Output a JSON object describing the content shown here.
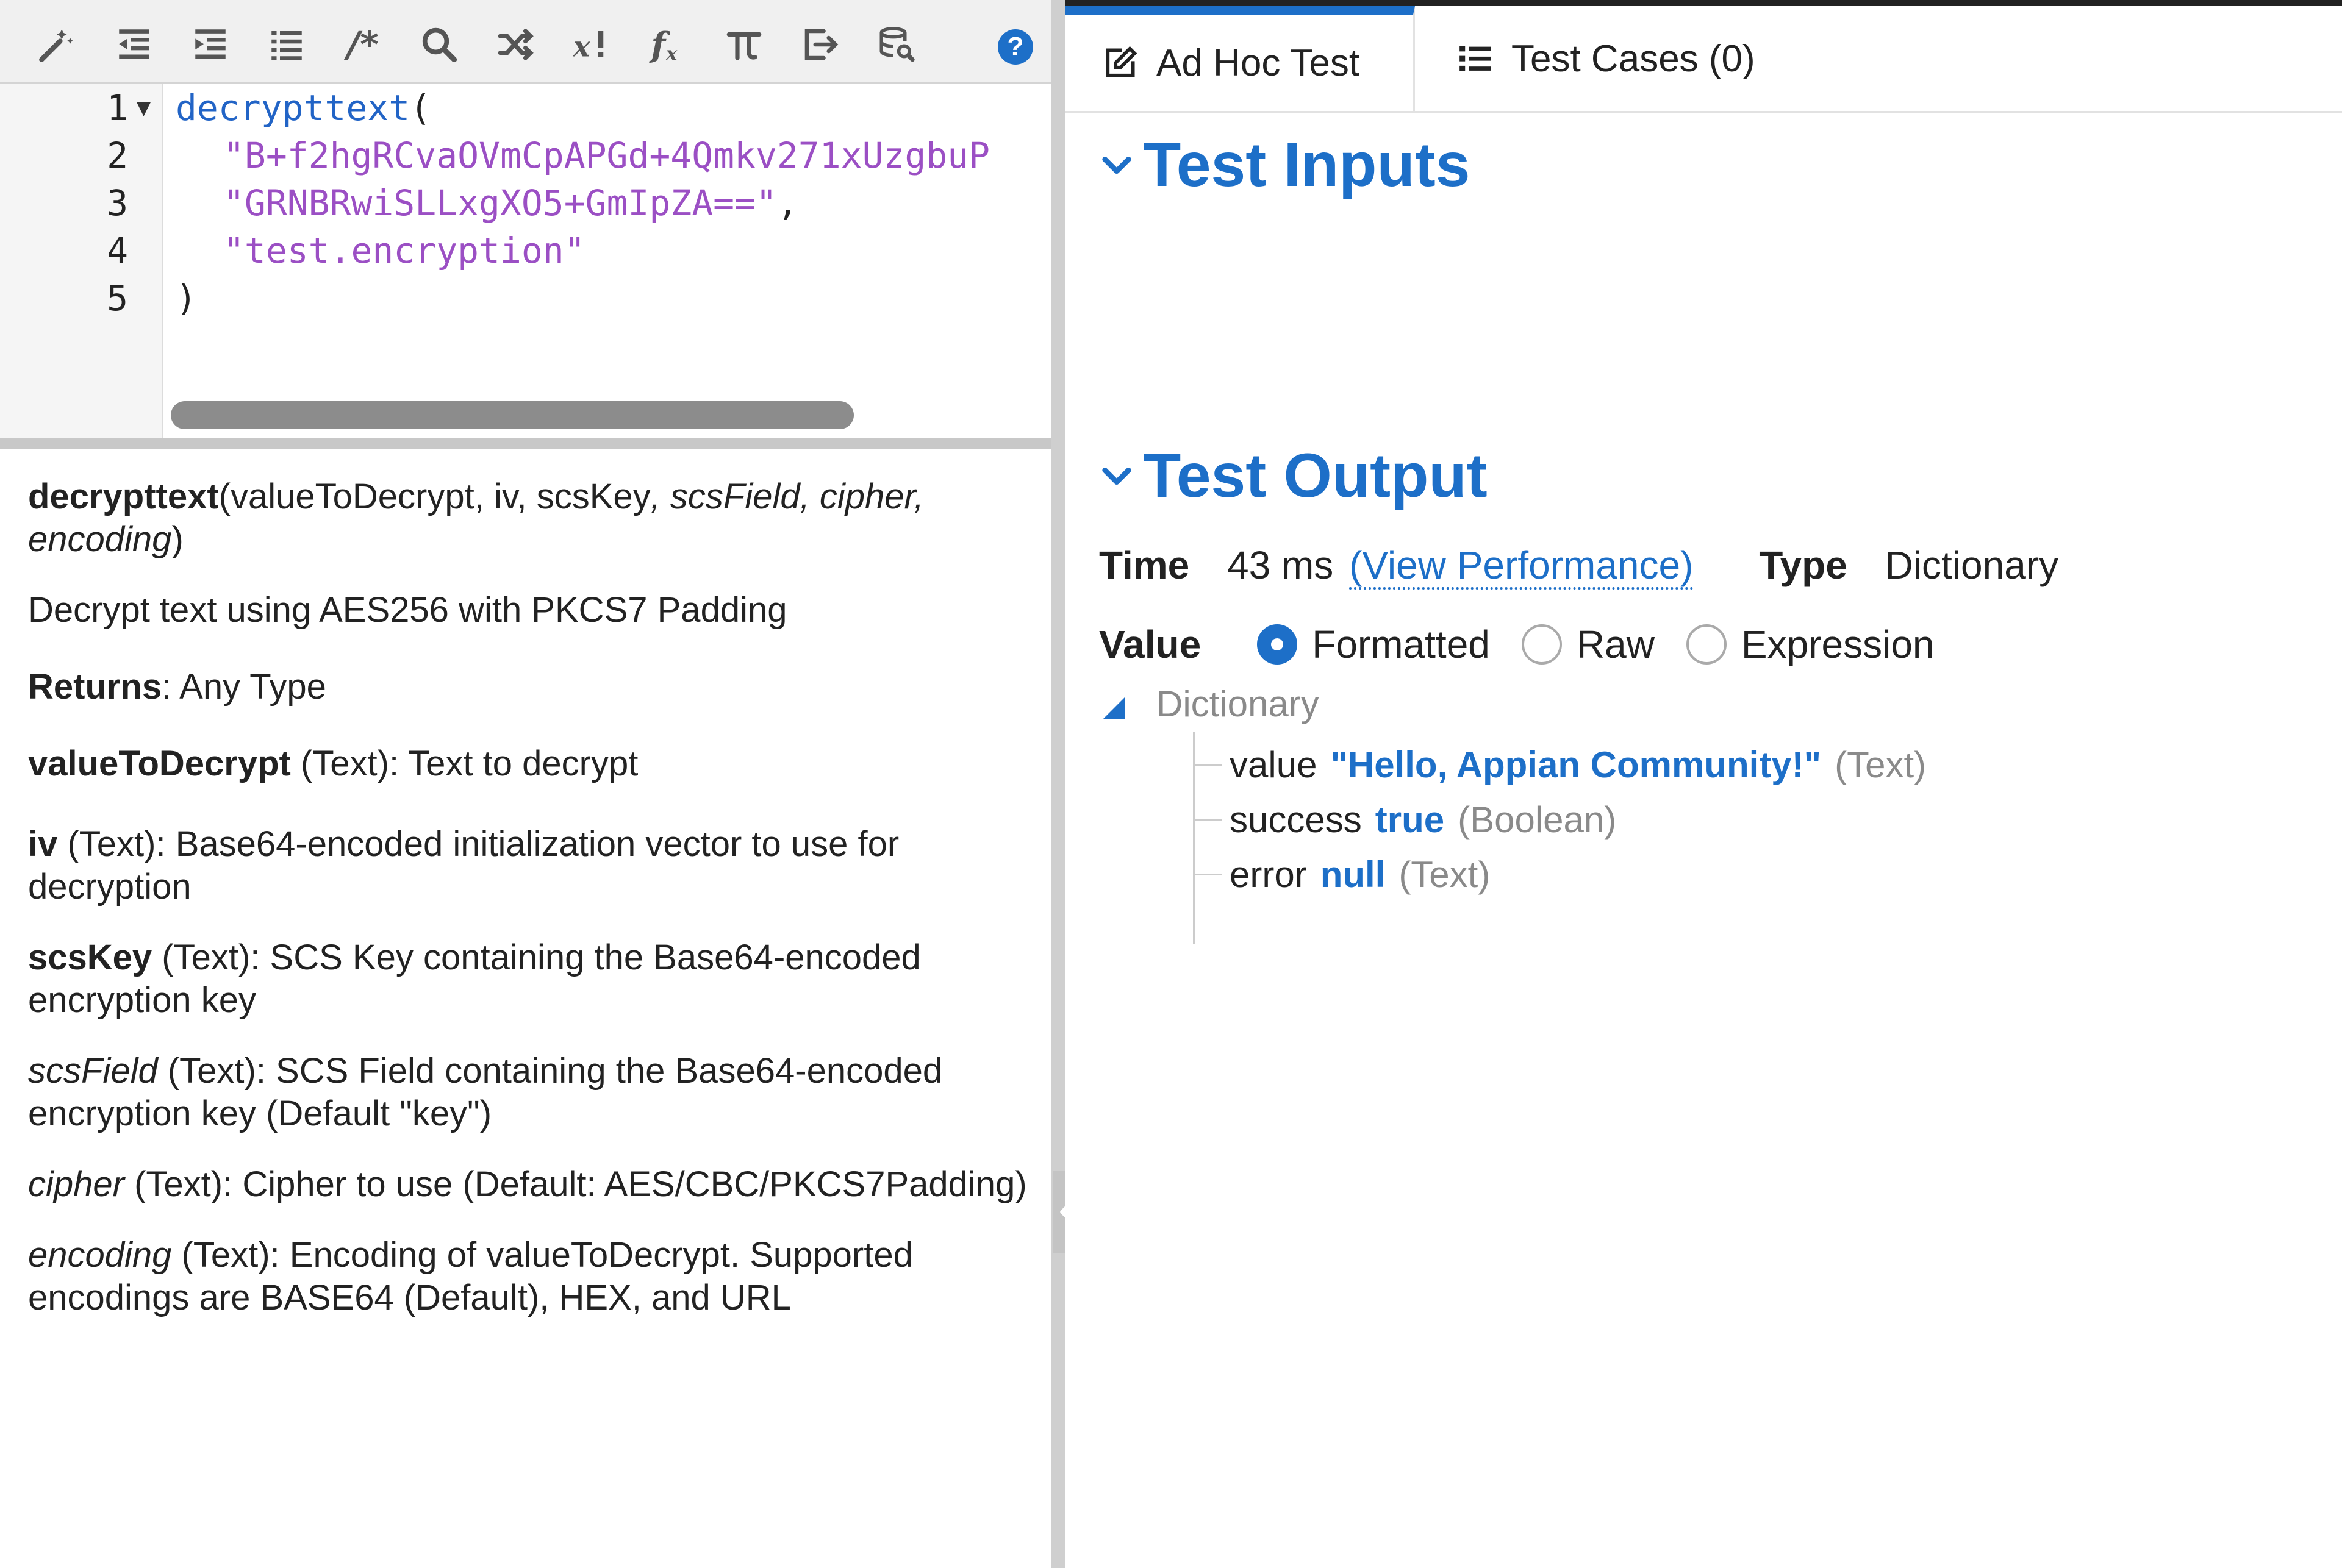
{
  "toolbar": {
    "icons": [
      "magic-wand-icon",
      "outdent-icon",
      "indent-icon",
      "list-icon",
      "comment-icon",
      "search-icon",
      "shuffle-icon",
      "variable-icon",
      "function-icon",
      "pi-icon",
      "export-icon",
      "database-search-icon",
      "help-icon"
    ],
    "comment_glyph": "/*",
    "help_glyph": "?"
  },
  "editor": {
    "line_numbers": [
      "1",
      "2",
      "3",
      "4",
      "5"
    ],
    "line1_fn": "decrypttext",
    "line1_paren": "(",
    "line2_str": "\"B+f2hgRCvaOVmCpAPGd+4Qmkv271xUzgbuP",
    "line3_str": "\"GRNBRwiSLLxgXO5+GmIpZA==\"",
    "line3_comma": ",",
    "line4_str": "\"test.encryption\"",
    "line5_paren": ")"
  },
  "docs": {
    "signature_name": "decrypttext",
    "signature_required": "(valueToDecrypt, iv, scsKey",
    "signature_optional": ", scsField, cipher, encoding",
    "signature_close": ")",
    "description": "Decrypt text using AES256 with PKCS7 Padding",
    "returns_label": "Returns",
    "returns_value": ": Any Type",
    "params": [
      {
        "name": "valueToDecrypt",
        "desc": " (Text): Text to decrypt",
        "optional": false
      },
      {
        "name": "iv",
        "desc": " (Text): Base64-encoded initialization vector to use for decryption",
        "optional": false
      },
      {
        "name": "scsKey",
        "desc": " (Text): SCS Key containing the Base64-encoded encryption key",
        "optional": false
      },
      {
        "name": "scsField",
        "desc": " (Text): SCS Field containing the Base64-encoded encryption key (Default \"key\")",
        "optional": true
      },
      {
        "name": "cipher",
        "desc": " (Text): Cipher to use (Default: AES/CBC/PKCS7Padding)",
        "optional": true
      },
      {
        "name": "encoding",
        "desc": " (Text): Encoding of valueToDecrypt. Supported encodings are BASE64 (Default), HEX, and URL",
        "optional": true
      }
    ]
  },
  "tabs": {
    "adhoc_label": "Ad Hoc Test",
    "cases_label": "Test Cases (0)"
  },
  "test_inputs": {
    "title": "Test Inputs"
  },
  "test_output": {
    "title": "Test Output",
    "time_label": "Time",
    "time_value": "43 ms",
    "view_performance": "(View Performance)",
    "type_label": "Type",
    "type_value": "Dictionary",
    "value_label": "Value",
    "value_modes": [
      "Formatted",
      "Raw",
      "Expression"
    ],
    "selected_mode": "Formatted",
    "tree": {
      "root": "Dictionary",
      "rows": [
        {
          "key": "value",
          "val": "\"Hello, Appian Community!\"",
          "type": "(Text)"
        },
        {
          "key": "success",
          "val": "true",
          "type": "(Boolean)"
        },
        {
          "key": "error",
          "val": "null",
          "type": "(Text)"
        }
      ]
    }
  },
  "colors": {
    "accent": "#1d6fc8",
    "string": "#9b4fc4",
    "function": "#2264c6",
    "muted": "#8a8a8a"
  }
}
